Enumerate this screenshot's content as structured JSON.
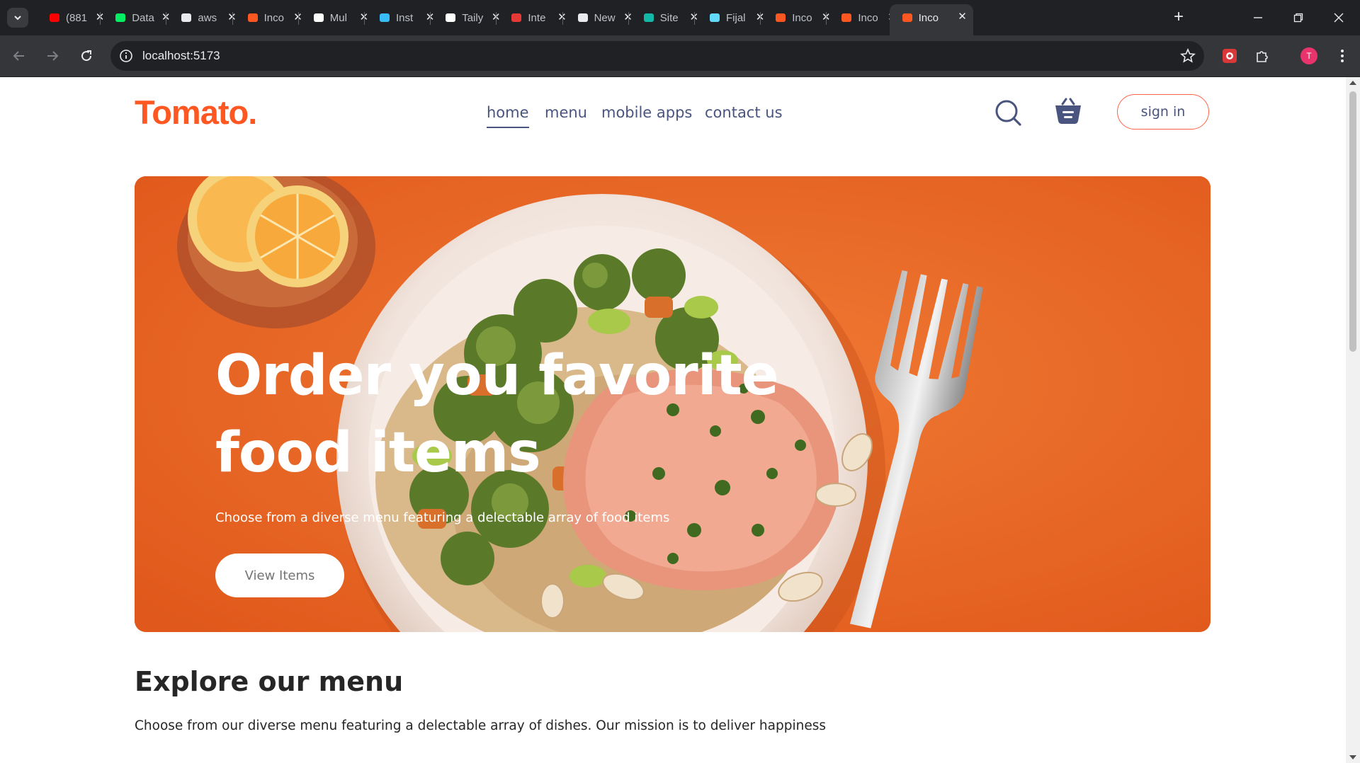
{
  "browser": {
    "tabs": [
      {
        "title": "(881",
        "icon": "youtube-icon",
        "color": "#ff0000"
      },
      {
        "title": "Data",
        "icon": "mongodb-icon",
        "color": "#00ed64"
      },
      {
        "title": "aws",
        "icon": "github-icon",
        "color": "#e8eaed"
      },
      {
        "title": "Inco",
        "icon": "app-icon",
        "color": "#ff5722"
      },
      {
        "title": "Mul",
        "icon": "mui-icon",
        "color": "#ffffff"
      },
      {
        "title": "Inst",
        "icon": "tailwind-icon",
        "color": "#38bdf8"
      },
      {
        "title": "Taily",
        "icon": "openai-icon",
        "color": "#ffffff"
      },
      {
        "title": "Inte",
        "icon": "arc-icon",
        "color": "#e53935"
      },
      {
        "title": "New",
        "icon": "chrome-icon",
        "color": "#e8eaed"
      },
      {
        "title": "Site",
        "icon": "diamond-icon",
        "color": "#14b8a6"
      },
      {
        "title": "Fijal",
        "icon": "react-icon",
        "color": "#61dafb"
      },
      {
        "title": "Inco",
        "icon": "app-icon",
        "color": "#ff5722"
      },
      {
        "title": "Inco",
        "icon": "app-icon",
        "color": "#ff5722"
      },
      {
        "title": "Inco",
        "icon": "app-icon",
        "color": "#ff5722",
        "active": true
      }
    ],
    "url": "localhost:5173",
    "profile_initial": "T"
  },
  "navbar": {
    "logo": "Tomato.",
    "links": [
      "home",
      "menu",
      "mobile apps",
      "contact us"
    ],
    "active_link": "home",
    "signin_label": "sign in"
  },
  "hero": {
    "title_line1": "Order you favorite",
    "title_line2": "food items",
    "subtitle": "Choose from a diverse menu featuring a delectable array of food items",
    "button_label": "View Items"
  },
  "explore": {
    "title": "Explore our menu",
    "text": "Choose from our diverse menu featuring a delectable array of dishes. Our mission is to deliver happiness"
  },
  "colors": {
    "brand": "#ff5722",
    "nav_text": "#49557e",
    "hero_bg": "#e85f20",
    "signin_border": "#ff6347"
  }
}
